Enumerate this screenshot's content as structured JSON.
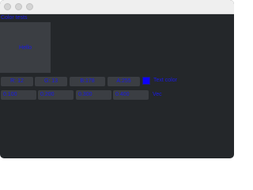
{
  "window": {
    "controls": [
      "close-button",
      "minimize-button",
      "maximize-button"
    ]
  },
  "header": {
    "label": "Color tests"
  },
  "preview": {
    "text": "Hello",
    "background": "#3b3e43"
  },
  "color_row": {
    "r": "R: 12",
    "g": "G: 13",
    "b": "B:178",
    "a": "A:255",
    "swatch_color": "#0d00ff",
    "label": "Text color"
  },
  "vec_row": {
    "values": [
      "0.100",
      "0.200",
      "0.300",
      "0.400"
    ],
    "label": "Vec"
  },
  "colors": {
    "text_accent": "#1a1ae6",
    "window_bg": "#24272a",
    "field_bg": "#3b3e43"
  }
}
